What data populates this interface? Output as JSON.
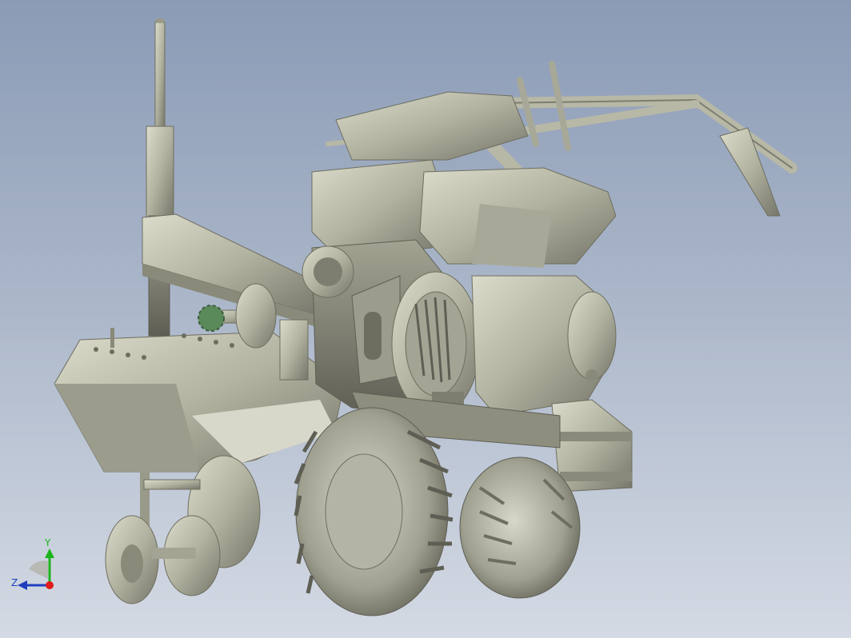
{
  "viewport": {
    "background_top": "#8b9bb6",
    "background_bottom": "#d4dae4",
    "model_color": "#b8b8a6",
    "model_shadow": "#6e6e60",
    "sprocket_color": "#5a8a5a"
  },
  "triad": {
    "y_label": "Y",
    "z_label": "Z",
    "y_color": "#1db31d",
    "z_color": "#1f3fbf",
    "x_color": "#e01b1b"
  }
}
